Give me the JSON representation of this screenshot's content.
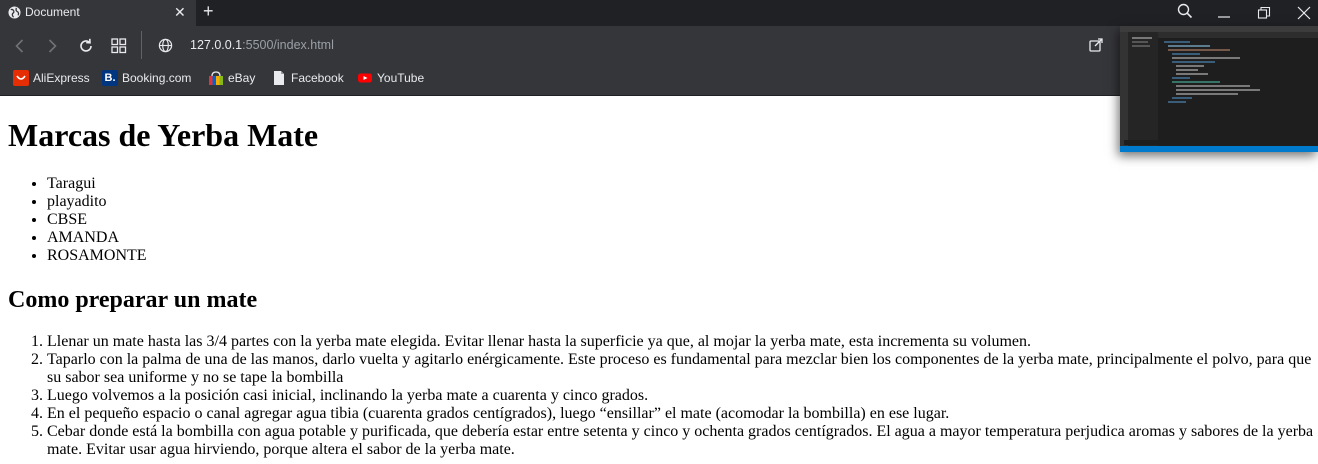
{
  "browser": {
    "tab_title": "Document",
    "url_host": "127.0.0.1",
    "url_path": ":5500/index.html",
    "bookmarks": [
      {
        "label": "AliExpress",
        "icon": "aliexpress-icon",
        "color": "#e62e04"
      },
      {
        "label": "Booking.com",
        "icon": "booking-icon",
        "color": "#003580"
      },
      {
        "label": "eBay",
        "icon": "ebay-icon",
        "color": "#e53238"
      },
      {
        "label": "Facebook",
        "icon": "file-icon",
        "color": "#e8eaed"
      },
      {
        "label": "YouTube",
        "icon": "youtube-icon",
        "color": "#ff0000"
      }
    ]
  },
  "page": {
    "heading": "Marcas de Yerba Mate",
    "brands": [
      "Taragui",
      "playadito",
      "CBSE",
      "AMANDA",
      "ROSAMONTE"
    ],
    "subheading": "Como preparar un mate",
    "steps": [
      "Llenar un mate hasta las 3/4 partes con la yerba mate elegida. Evitar llenar hasta la superficie ya que, al mojar la yerba mate, esta incrementa su volumen.",
      "Taparlo con la palma de una de las manos, darlo vuelta y agitarlo enérgicamente. Este proceso es fundamental para mezclar bien los componentes de la yerba mate, principalmente el polvo, para que su sabor sea uniforme y no se tape la bombilla",
      "Luego volvemos a la posición casi inicial, inclinando la yerba mate a cuarenta y cinco grados.",
      "En el pequeño espacio o canal agregar agua tibia (cuarenta grados centígrados), luego “ensillar” el mate (acomodar la bombilla) en ese lugar.",
      "Cebar donde está la bombilla con agua potable y purificada, que debería estar entre setenta y cinco y ochenta grados centígrados. El agua a mayor temperatura perjudica aromas y sabores de la yerba mate. Evitar usar agua hirviendo, porque altera el sabor de la yerba mate."
    ]
  }
}
